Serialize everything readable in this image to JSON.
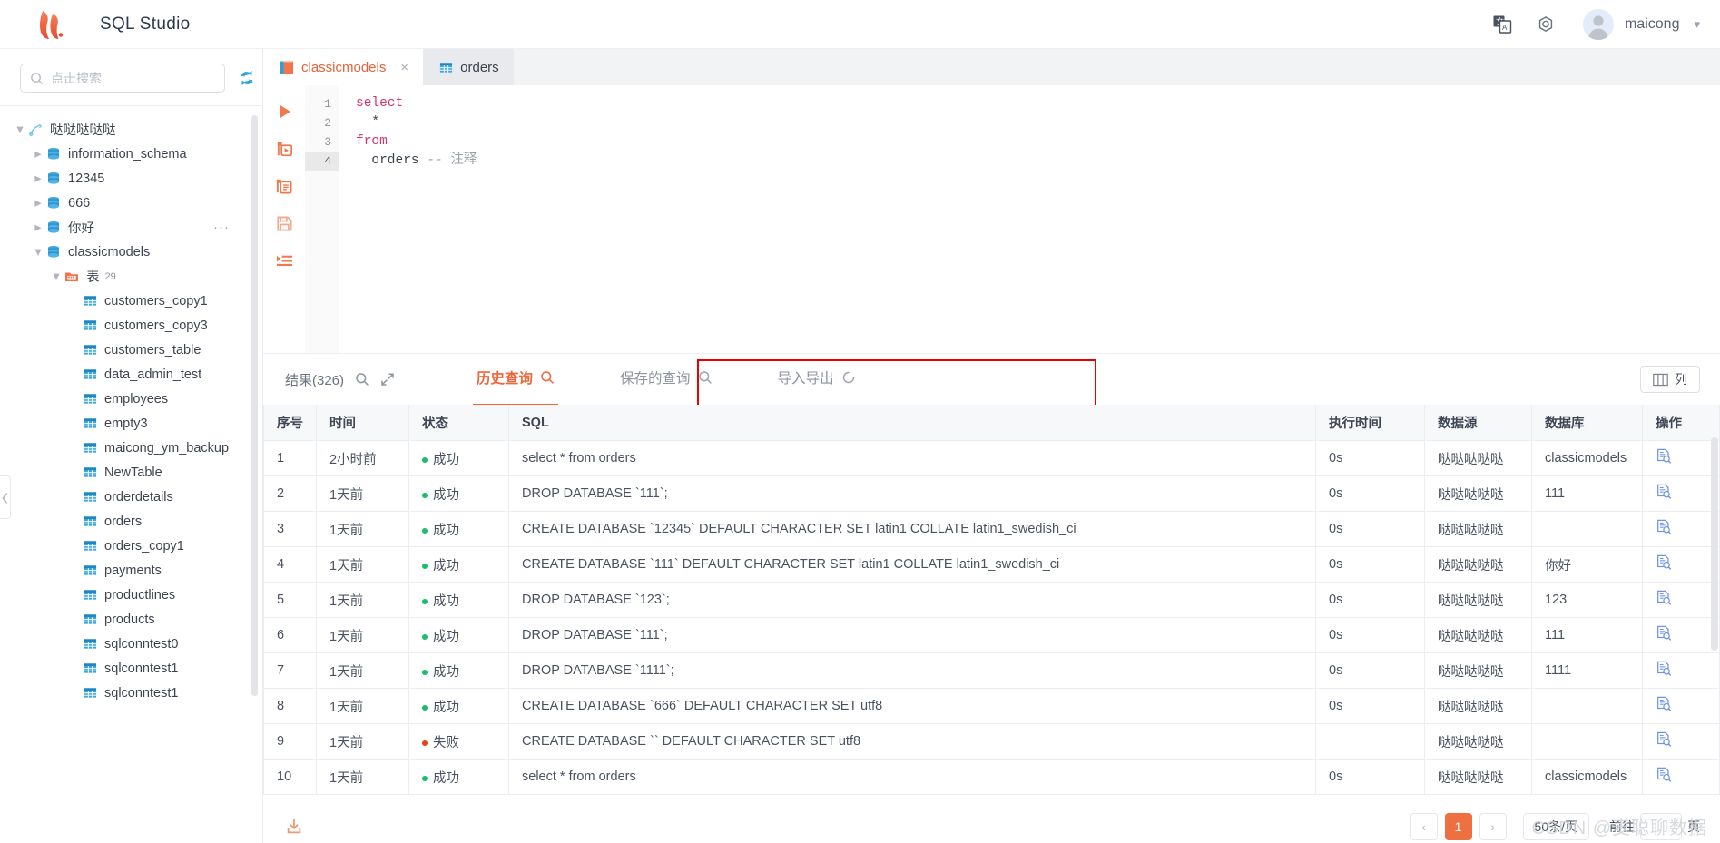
{
  "header": {
    "app_title": "SQL Studio",
    "logo_name": "flame-logo",
    "language_icon": "language-icon",
    "settings_icon": "gear-icon",
    "avatar_icon": "user-avatar",
    "user_name": "maicong",
    "caret_icon": "chevron-down-icon"
  },
  "sidebar": {
    "search": {
      "placeholder": "点击搜索",
      "value": "",
      "icon": "search-icon"
    },
    "refresh_icon": "refresh-icon",
    "collapse_icon": "chevron-left-icon",
    "tree": [
      {
        "label": "哒哒哒哒哒",
        "icon": "connection-icon",
        "depth": 0,
        "expanded": true,
        "arrow": "down"
      },
      {
        "label": "information_schema",
        "icon": "database-icon",
        "depth": 1,
        "expanded": false,
        "arrow": "right"
      },
      {
        "label": "12345",
        "icon": "database-icon",
        "depth": 1,
        "expanded": false,
        "arrow": "right"
      },
      {
        "label": "666",
        "icon": "database-icon",
        "depth": 1,
        "expanded": false,
        "arrow": "right"
      },
      {
        "label": "你好",
        "icon": "database-icon",
        "depth": 1,
        "expanded": false,
        "arrow": "right",
        "more": "..."
      },
      {
        "label": "classicmodels",
        "icon": "database-icon",
        "depth": 1,
        "expanded": true,
        "arrow": "down"
      },
      {
        "label": "表",
        "count": "29",
        "icon": "folder-icon",
        "depth": 2,
        "expanded": true,
        "arrow": "down"
      },
      {
        "label": "customers_copy1",
        "icon": "table-icon",
        "depth": 3,
        "arrow": "none"
      },
      {
        "label": "customers_copy3",
        "icon": "table-icon",
        "depth": 3,
        "arrow": "none"
      },
      {
        "label": "customers_table",
        "icon": "table-icon",
        "depth": 3,
        "arrow": "none"
      },
      {
        "label": "data_admin_test",
        "icon": "table-icon",
        "depth": 3,
        "arrow": "none"
      },
      {
        "label": "employees",
        "icon": "table-icon",
        "depth": 3,
        "arrow": "none"
      },
      {
        "label": "empty3",
        "icon": "table-icon",
        "depth": 3,
        "arrow": "none"
      },
      {
        "label": "maicong_ym_backup",
        "icon": "table-icon",
        "depth": 3,
        "arrow": "none"
      },
      {
        "label": "NewTable",
        "icon": "table-icon",
        "depth": 3,
        "arrow": "none"
      },
      {
        "label": "orderdetails",
        "icon": "table-icon",
        "depth": 3,
        "arrow": "none"
      },
      {
        "label": "orders",
        "icon": "table-icon",
        "depth": 3,
        "arrow": "none"
      },
      {
        "label": "orders_copy1",
        "icon": "table-icon",
        "depth": 3,
        "arrow": "none"
      },
      {
        "label": "payments",
        "icon": "table-icon",
        "depth": 3,
        "arrow": "none"
      },
      {
        "label": "productlines",
        "icon": "table-icon",
        "depth": 3,
        "arrow": "none"
      },
      {
        "label": "products",
        "icon": "table-icon",
        "depth": 3,
        "arrow": "none"
      },
      {
        "label": "sqlconntest0",
        "icon": "table-icon",
        "depth": 3,
        "arrow": "none"
      },
      {
        "label": "sqlconntest1",
        "icon": "table-icon",
        "depth": 3,
        "arrow": "none"
      },
      {
        "label": "sqlconntest1",
        "icon": "table-icon",
        "depth": 3,
        "arrow": "none"
      }
    ]
  },
  "editor": {
    "tabs": [
      {
        "label": "classicmodels",
        "icon": "sql-file-icon",
        "active": true,
        "closable": true,
        "close_label": "×"
      },
      {
        "label": "orders",
        "icon": "table-icon",
        "active": false,
        "closable": false
      }
    ],
    "toolbar": [
      {
        "name": "run-button",
        "icon": "play-icon"
      },
      {
        "name": "run-selection-button",
        "icon": "run-step-icon"
      },
      {
        "name": "format-button",
        "icon": "format-doc-icon"
      },
      {
        "name": "save-button",
        "icon": "save-icon"
      },
      {
        "name": "explain-button",
        "icon": "list-indent-icon"
      }
    ],
    "lines": [
      {
        "no": "1",
        "current": false,
        "tokens": [
          {
            "t": "select",
            "c": "kw"
          }
        ]
      },
      {
        "no": "2",
        "current": false,
        "tokens": [
          {
            "t": "  *",
            "c": "tok"
          }
        ]
      },
      {
        "no": "3",
        "current": false,
        "tokens": [
          {
            "t": "from",
            "c": "kw"
          }
        ]
      },
      {
        "no": "4",
        "current": true,
        "tokens": [
          {
            "t": "  orders ",
            "c": "tok"
          },
          {
            "t": "-- 注释",
            "c": "cmt"
          }
        ]
      }
    ]
  },
  "results": {
    "result_label": "结果(326)",
    "search_icon": "search-icon",
    "expand_icon": "expand-arrows-icon",
    "tabs": [
      {
        "label": "历史查询",
        "icon": "search-icon",
        "active": true
      },
      {
        "label": "保存的查询",
        "icon": "search-icon",
        "active": false
      },
      {
        "label": "导入导出",
        "icon": "sync-icon",
        "active": false
      }
    ],
    "columns_button": {
      "label": "列",
      "icon": "columns-icon"
    },
    "highlight_color": "#ee0000",
    "accent_color": "#f0663a",
    "table": {
      "headers": [
        "序号",
        "时间",
        "状态",
        "SQL",
        "执行时间",
        "数据源",
        "数据库",
        "操作"
      ],
      "rows": [
        {
          "no": "1",
          "time": "2小时前",
          "status": "成功",
          "status_ok": true,
          "sql": "select * from orders",
          "exec": "0s",
          "source": "哒哒哒哒哒",
          "db": "classicmodels",
          "action_icon": "doc-search-icon"
        },
        {
          "no": "2",
          "time": "1天前",
          "status": "成功",
          "status_ok": true,
          "sql": "DROP DATABASE `111`;",
          "exec": "0s",
          "source": "哒哒哒哒哒",
          "db": "111",
          "action_icon": "doc-search-icon"
        },
        {
          "no": "3",
          "time": "1天前",
          "status": "成功",
          "status_ok": true,
          "sql": "CREATE DATABASE `12345` DEFAULT CHARACTER SET latin1 COLLATE latin1_swedish_ci",
          "exec": "0s",
          "source": "哒哒哒哒哒",
          "db": "",
          "action_icon": "doc-search-icon"
        },
        {
          "no": "4",
          "time": "1天前",
          "status": "成功",
          "status_ok": true,
          "sql": "CREATE DATABASE `111` DEFAULT CHARACTER SET latin1 COLLATE latin1_swedish_ci",
          "exec": "0s",
          "source": "哒哒哒哒哒",
          "db": "你好",
          "action_icon": "doc-search-icon"
        },
        {
          "no": "5",
          "time": "1天前",
          "status": "成功",
          "status_ok": true,
          "sql": "DROP DATABASE `123`;",
          "exec": "0s",
          "source": "哒哒哒哒哒",
          "db": "123",
          "action_icon": "doc-search-icon"
        },
        {
          "no": "6",
          "time": "1天前",
          "status": "成功",
          "status_ok": true,
          "sql": "DROP DATABASE `111`;",
          "exec": "0s",
          "source": "哒哒哒哒哒",
          "db": "111",
          "action_icon": "doc-search-icon"
        },
        {
          "no": "7",
          "time": "1天前",
          "status": "成功",
          "status_ok": true,
          "sql": "DROP DATABASE `1111`;",
          "exec": "0s",
          "source": "哒哒哒哒哒",
          "db": "1111",
          "action_icon": "doc-search-icon"
        },
        {
          "no": "8",
          "time": "1天前",
          "status": "成功",
          "status_ok": true,
          "sql": "CREATE DATABASE `666` DEFAULT CHARACTER SET utf8",
          "exec": "0s",
          "source": "哒哒哒哒哒",
          "db": "",
          "action_icon": "doc-search-icon"
        },
        {
          "no": "9",
          "time": "1天前",
          "status": "失败",
          "status_ok": false,
          "sql": "CREATE DATABASE `` DEFAULT CHARACTER SET utf8",
          "exec": "",
          "source": "哒哒哒哒哒",
          "db": "",
          "action_icon": "doc-search-icon"
        },
        {
          "no": "10",
          "time": "1天前",
          "status": "成功",
          "status_ok": true,
          "sql": "select * from orders",
          "exec": "0s",
          "source": "哒哒哒哒哒",
          "db": "classicmodels",
          "action_icon": "doc-search-icon"
        }
      ]
    }
  },
  "footer": {
    "download_icon": "download-icon",
    "prev_label": "‹",
    "next_label": "›",
    "current_page": "1",
    "page_size": "50条/页",
    "jump_prefix": "前往",
    "jump_value": "",
    "jump_suffix": "页",
    "watermark": "CSDN @麦聪聊数据"
  }
}
